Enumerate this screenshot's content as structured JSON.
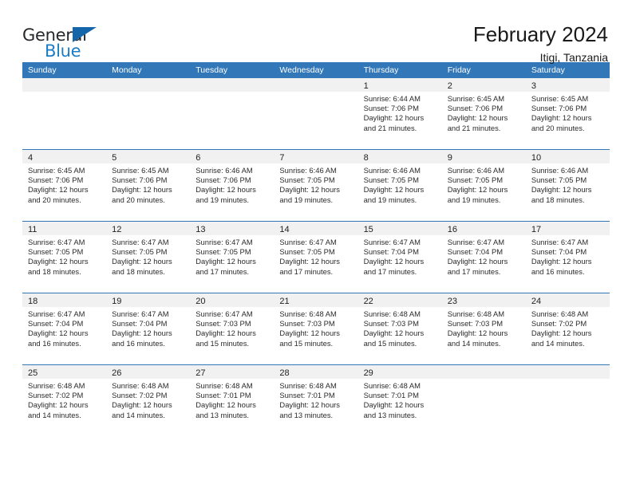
{
  "brand": {
    "name_top": "General",
    "name_bottom": "Blue",
    "flag_icon": "triangle-flag-icon",
    "color_dark": "#26282b",
    "color_blue": "#1d7dc4"
  },
  "header": {
    "title": "February 2024",
    "subtitle": "Itigi, Tanzania"
  },
  "theme": {
    "header_blue": "#3277b8",
    "date_band_gray": "#f1f1f1",
    "cell_white": "#ffffff",
    "text_dark": "#2b2b2b"
  },
  "calendar": {
    "weekdays": [
      "Sunday",
      "Monday",
      "Tuesday",
      "Wednesday",
      "Thursday",
      "Friday",
      "Saturday"
    ],
    "weeks": [
      [
        {
          "day": "",
          "lines": []
        },
        {
          "day": "",
          "lines": []
        },
        {
          "day": "",
          "lines": []
        },
        {
          "day": "",
          "lines": []
        },
        {
          "day": "1",
          "lines": [
            "Sunrise: 6:44 AM",
            "Sunset: 7:06 PM",
            "Daylight: 12 hours",
            "and 21 minutes."
          ]
        },
        {
          "day": "2",
          "lines": [
            "Sunrise: 6:45 AM",
            "Sunset: 7:06 PM",
            "Daylight: 12 hours",
            "and 21 minutes."
          ]
        },
        {
          "day": "3",
          "lines": [
            "Sunrise: 6:45 AM",
            "Sunset: 7:06 PM",
            "Daylight: 12 hours",
            "and 20 minutes."
          ]
        }
      ],
      [
        {
          "day": "4",
          "lines": [
            "Sunrise: 6:45 AM",
            "Sunset: 7:06 PM",
            "Daylight: 12 hours",
            "and 20 minutes."
          ]
        },
        {
          "day": "5",
          "lines": [
            "Sunrise: 6:45 AM",
            "Sunset: 7:06 PM",
            "Daylight: 12 hours",
            "and 20 minutes."
          ]
        },
        {
          "day": "6",
          "lines": [
            "Sunrise: 6:46 AM",
            "Sunset: 7:06 PM",
            "Daylight: 12 hours",
            "and 19 minutes."
          ]
        },
        {
          "day": "7",
          "lines": [
            "Sunrise: 6:46 AM",
            "Sunset: 7:05 PM",
            "Daylight: 12 hours",
            "and 19 minutes."
          ]
        },
        {
          "day": "8",
          "lines": [
            "Sunrise: 6:46 AM",
            "Sunset: 7:05 PM",
            "Daylight: 12 hours",
            "and 19 minutes."
          ]
        },
        {
          "day": "9",
          "lines": [
            "Sunrise: 6:46 AM",
            "Sunset: 7:05 PM",
            "Daylight: 12 hours",
            "and 19 minutes."
          ]
        },
        {
          "day": "10",
          "lines": [
            "Sunrise: 6:46 AM",
            "Sunset: 7:05 PM",
            "Daylight: 12 hours",
            "and 18 minutes."
          ]
        }
      ],
      [
        {
          "day": "11",
          "lines": [
            "Sunrise: 6:47 AM",
            "Sunset: 7:05 PM",
            "Daylight: 12 hours",
            "and 18 minutes."
          ]
        },
        {
          "day": "12",
          "lines": [
            "Sunrise: 6:47 AM",
            "Sunset: 7:05 PM",
            "Daylight: 12 hours",
            "and 18 minutes."
          ]
        },
        {
          "day": "13",
          "lines": [
            "Sunrise: 6:47 AM",
            "Sunset: 7:05 PM",
            "Daylight: 12 hours",
            "and 17 minutes."
          ]
        },
        {
          "day": "14",
          "lines": [
            "Sunrise: 6:47 AM",
            "Sunset: 7:05 PM",
            "Daylight: 12 hours",
            "and 17 minutes."
          ]
        },
        {
          "day": "15",
          "lines": [
            "Sunrise: 6:47 AM",
            "Sunset: 7:04 PM",
            "Daylight: 12 hours",
            "and 17 minutes."
          ]
        },
        {
          "day": "16",
          "lines": [
            "Sunrise: 6:47 AM",
            "Sunset: 7:04 PM",
            "Daylight: 12 hours",
            "and 17 minutes."
          ]
        },
        {
          "day": "17",
          "lines": [
            "Sunrise: 6:47 AM",
            "Sunset: 7:04 PM",
            "Daylight: 12 hours",
            "and 16 minutes."
          ]
        }
      ],
      [
        {
          "day": "18",
          "lines": [
            "Sunrise: 6:47 AM",
            "Sunset: 7:04 PM",
            "Daylight: 12 hours",
            "and 16 minutes."
          ]
        },
        {
          "day": "19",
          "lines": [
            "Sunrise: 6:47 AM",
            "Sunset: 7:04 PM",
            "Daylight: 12 hours",
            "and 16 minutes."
          ]
        },
        {
          "day": "20",
          "lines": [
            "Sunrise: 6:47 AM",
            "Sunset: 7:03 PM",
            "Daylight: 12 hours",
            "and 15 minutes."
          ]
        },
        {
          "day": "21",
          "lines": [
            "Sunrise: 6:48 AM",
            "Sunset: 7:03 PM",
            "Daylight: 12 hours",
            "and 15 minutes."
          ]
        },
        {
          "day": "22",
          "lines": [
            "Sunrise: 6:48 AM",
            "Sunset: 7:03 PM",
            "Daylight: 12 hours",
            "and 15 minutes."
          ]
        },
        {
          "day": "23",
          "lines": [
            "Sunrise: 6:48 AM",
            "Sunset: 7:03 PM",
            "Daylight: 12 hours",
            "and 14 minutes."
          ]
        },
        {
          "day": "24",
          "lines": [
            "Sunrise: 6:48 AM",
            "Sunset: 7:02 PM",
            "Daylight: 12 hours",
            "and 14 minutes."
          ]
        }
      ],
      [
        {
          "day": "25",
          "lines": [
            "Sunrise: 6:48 AM",
            "Sunset: 7:02 PM",
            "Daylight: 12 hours",
            "and 14 minutes."
          ]
        },
        {
          "day": "26",
          "lines": [
            "Sunrise: 6:48 AM",
            "Sunset: 7:02 PM",
            "Daylight: 12 hours",
            "and 14 minutes."
          ]
        },
        {
          "day": "27",
          "lines": [
            "Sunrise: 6:48 AM",
            "Sunset: 7:01 PM",
            "Daylight: 12 hours",
            "and 13 minutes."
          ]
        },
        {
          "day": "28",
          "lines": [
            "Sunrise: 6:48 AM",
            "Sunset: 7:01 PM",
            "Daylight: 12 hours",
            "and 13 minutes."
          ]
        },
        {
          "day": "29",
          "lines": [
            "Sunrise: 6:48 AM",
            "Sunset: 7:01 PM",
            "Daylight: 12 hours",
            "and 13 minutes."
          ]
        },
        {
          "day": "",
          "lines": []
        },
        {
          "day": "",
          "lines": []
        }
      ]
    ]
  }
}
